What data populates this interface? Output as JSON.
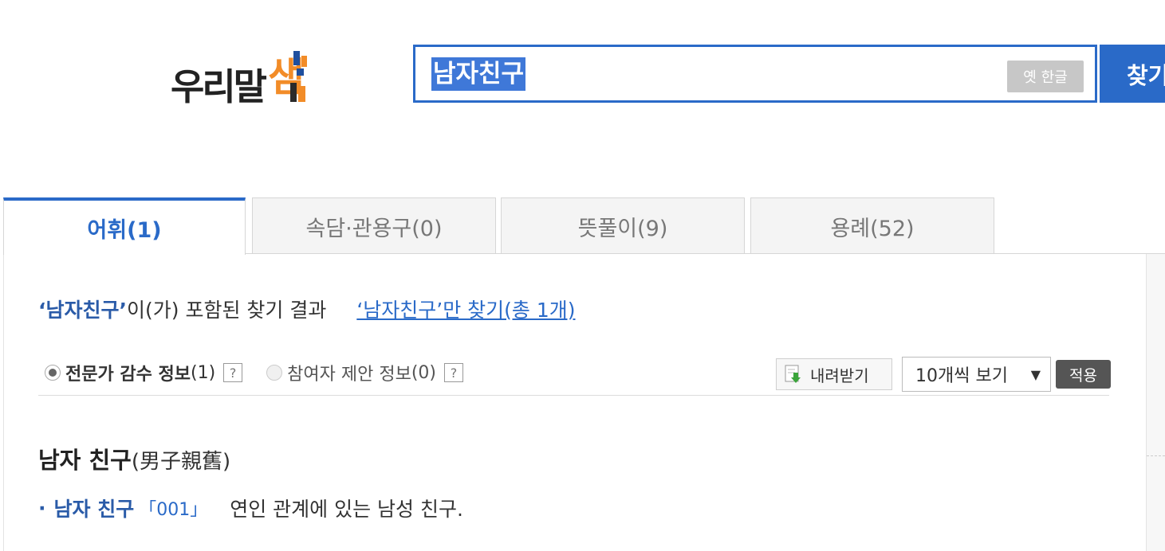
{
  "header": {
    "logo_text": "우리말",
    "logo_mark_text": "샘",
    "search_value": "남자친구",
    "old_hangul_label": "옛 한글",
    "search_button_label": "찾기"
  },
  "tabs": [
    {
      "label": "어휘(1)",
      "active": true
    },
    {
      "label": "속담·관용구(0)",
      "active": false
    },
    {
      "label": "뜻풀이(9)",
      "active": false
    },
    {
      "label": "용례(52)",
      "active": false
    }
  ],
  "summary": {
    "keyword": "‘남자친구’",
    "suffix": "이(가) 포함된 찾기 결과",
    "link": "‘남자친구’만 찾기(총 1개)"
  },
  "filters": {
    "expert_label": "전문가 감수 정보",
    "expert_count": "(1)",
    "participant_label": "참여자 제안 정보",
    "participant_count": "(0)",
    "help_glyph": "?",
    "download_label": "내려받기",
    "page_size_value": "10개씩 보기",
    "page_size_arrow": "▼",
    "apply_label": "적용"
  },
  "entry": {
    "headword": "남자 친구",
    "hanja": "(男子親舊)",
    "senses": [
      {
        "bullet": "·",
        "word": "남자 친구",
        "number": "「001」",
        "definition": "연인 관계에 있는 남성 친구."
      }
    ]
  },
  "colors": {
    "brand_blue": "#2a6ac8",
    "keyword_blue": "#2a5ba8",
    "logo_orange": "#f28c28",
    "apply_gray": "#555555"
  }
}
